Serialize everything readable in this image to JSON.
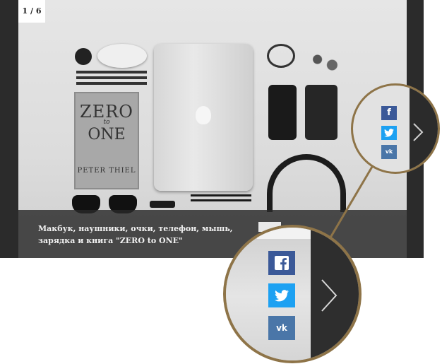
{
  "slider": {
    "counter": "1 / 6",
    "caption": "Макбук, наушники, очки, телефон, мышь, зарядка и книга \"ZERO to ONE\"",
    "next_icon": "chevron-right-icon"
  },
  "book": {
    "title_line1": "ZERO",
    "title_line2": "to",
    "title_line3": "ONE",
    "author": "PETER THIEL"
  },
  "share": {
    "facebook_icon": "facebook-icon",
    "twitter_icon": "twitter-icon",
    "vk_icon": "vk-icon",
    "facebook_glyph": "f",
    "vk_glyph": "vk",
    "colors": {
      "facebook": "#3b5998",
      "twitter": "#1da1f2",
      "vk": "#4a76a8",
      "callout": "#8e7448"
    }
  }
}
